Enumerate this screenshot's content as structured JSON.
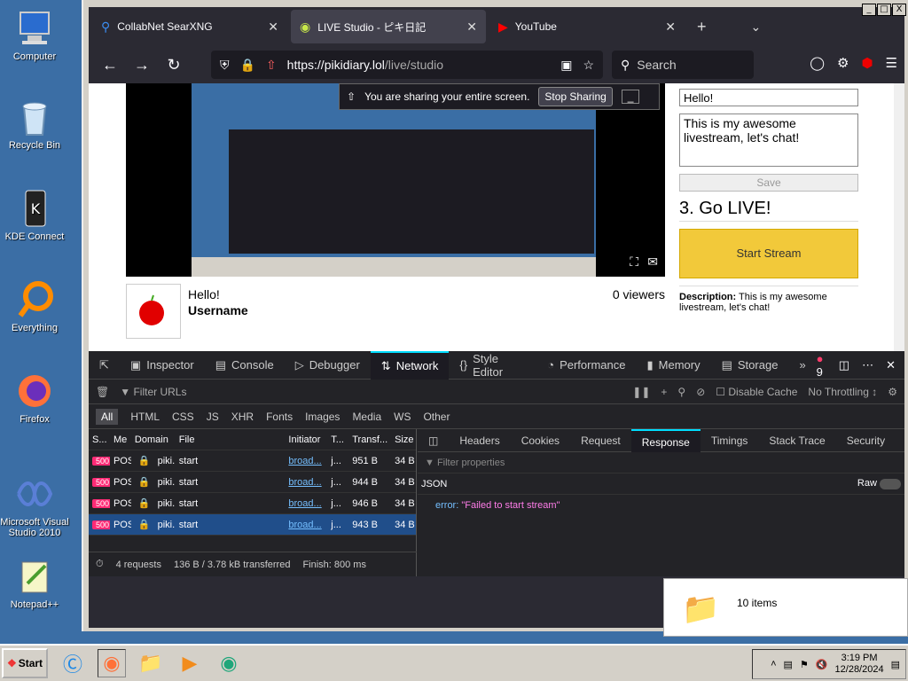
{
  "desktop": {
    "icons": [
      {
        "label": "Computer"
      },
      {
        "label": "Recycle Bin"
      },
      {
        "label": "KDE Connect"
      },
      {
        "label": "Everything"
      },
      {
        "label": "Firefox"
      },
      {
        "label": "Microsoft Visual Studio 2010"
      },
      {
        "label": "Notepad++"
      }
    ]
  },
  "browser": {
    "tabs": [
      {
        "title": "CollabNet SearXNG"
      },
      {
        "title": "LIVE Studio - ピキ日記"
      },
      {
        "title": "YouTube"
      }
    ],
    "url_host": "https://pikidiary.lol",
    "url_path": "/live/studio",
    "search_placeholder": "Search",
    "window_controls": [
      "_",
      "□",
      "X"
    ]
  },
  "page": {
    "share_notice": "You are sharing your entire screen.",
    "stop_sharing": "Stop Sharing",
    "stream_title": "Hello!",
    "stream_user": "Username",
    "viewers": "0 viewers",
    "title_input": "Hello!",
    "desc_input": "This is my awesome livestream, let's chat!",
    "save_label": "Save",
    "go_live_heading": "3. Go LIVE!",
    "start_stream": "Start Stream",
    "description_label": "Description:",
    "description_text": "This is my awesome livestream, let's chat!"
  },
  "devtools": {
    "tabs": [
      "Inspector",
      "Console",
      "Debugger",
      "Network",
      "Style Editor",
      "Performance",
      "Memory",
      "Storage"
    ],
    "error_count": "9",
    "filter_placeholder": "Filter URLs",
    "disable_cache": "Disable Cache",
    "throttling": "No Throttling ↕",
    "type_filters": [
      "All",
      "HTML",
      "CSS",
      "JS",
      "XHR",
      "Fonts",
      "Images",
      "Media",
      "WS",
      "Other"
    ],
    "columns": [
      "S...",
      "Me",
      "Domain",
      "File",
      "Initiator",
      "T...",
      "Transf...",
      "Size"
    ],
    "requests": [
      {
        "status": "500",
        "method": "POS",
        "domain": "piki...",
        "file": "start",
        "initiator": "broad...",
        "type": "j...",
        "transferred": "951 B",
        "size": "34 B"
      },
      {
        "status": "500",
        "method": "POS",
        "domain": "piki...",
        "file": "start",
        "initiator": "broad...",
        "type": "j...",
        "transferred": "944 B",
        "size": "34 B"
      },
      {
        "status": "500",
        "method": "POS",
        "domain": "piki...",
        "file": "start",
        "initiator": "broad...",
        "type": "j...",
        "transferred": "946 B",
        "size": "34 B"
      },
      {
        "status": "500",
        "method": "POS",
        "domain": "piki...",
        "file": "start",
        "initiator": "broad...",
        "type": "j...",
        "transferred": "943 B",
        "size": "34 B"
      }
    ],
    "footer": {
      "requests": "4 requests",
      "transferred": "136 B / 3.78 kB transferred",
      "finish": "Finish: 800 ms"
    },
    "response_tabs": [
      "Headers",
      "Cookies",
      "Request",
      "Response",
      "Timings",
      "Stack Trace",
      "Security"
    ],
    "filter_props": "Filter properties",
    "json_label": "JSON",
    "raw_label": "Raw",
    "error_key": "error:",
    "error_value": "\"Failed to start stream\""
  },
  "explorer": {
    "items": "10 items"
  },
  "taskbar": {
    "start": "Start",
    "time": "3:19 PM",
    "date": "12/28/2024"
  }
}
